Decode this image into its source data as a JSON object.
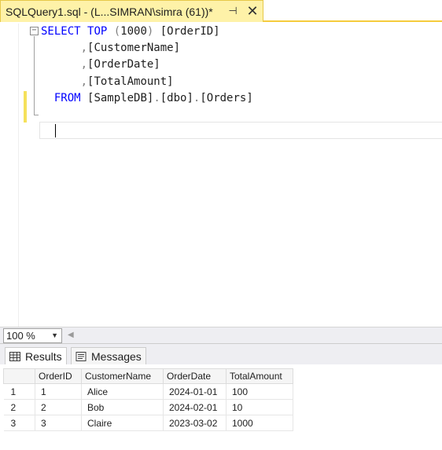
{
  "tab": {
    "title": "SQLQuery1.sql - (L...SIMRAN\\simra (61))*",
    "pin_glyph": "⊣",
    "close_glyph": "✕"
  },
  "editor": {
    "lines": [
      [
        {
          "t": "SELECT ",
          "c": "kw"
        },
        {
          "t": "TOP ",
          "c": "kw"
        },
        {
          "t": "(",
          "c": "pn"
        },
        {
          "t": "1000",
          "c": "num"
        },
        {
          "t": ") ",
          "c": "pn"
        },
        {
          "t": "[OrderID]",
          "c": "id"
        }
      ],
      [
        {
          "t": "      ",
          "c": "id"
        },
        {
          "t": ",",
          "c": "pn"
        },
        {
          "t": "[CustomerName]",
          "c": "id"
        }
      ],
      [
        {
          "t": "      ",
          "c": "id"
        },
        {
          "t": ",",
          "c": "pn"
        },
        {
          "t": "[OrderDate]",
          "c": "id"
        }
      ],
      [
        {
          "t": "      ",
          "c": "id"
        },
        {
          "t": ",",
          "c": "pn"
        },
        {
          "t": "[TotalAmount]",
          "c": "id"
        }
      ],
      [
        {
          "t": "  FROM ",
          "c": "kw"
        },
        {
          "t": "[SampleDB]",
          "c": "id"
        },
        {
          "t": ".",
          "c": "pn"
        },
        {
          "t": "[dbo]",
          "c": "id"
        },
        {
          "t": ".",
          "c": "pn"
        },
        {
          "t": "[Orders]",
          "c": "id"
        }
      ]
    ],
    "fold_glyph": "−"
  },
  "zoom": {
    "value": "100 %",
    "arrow": "▼",
    "scroll_left": "◀"
  },
  "results": {
    "tabs": [
      {
        "label": "Results",
        "icon": "grid-icon",
        "active": true
      },
      {
        "label": "Messages",
        "icon": "messages-icon",
        "active": false
      }
    ],
    "columns": [
      "OrderID",
      "CustomerName",
      "OrderDate",
      "TotalAmount"
    ],
    "rows": [
      {
        "rownum": "1",
        "cells": [
          "1",
          "Alice",
          "2024-01-01",
          "100"
        ]
      },
      {
        "rownum": "2",
        "cells": [
          "2",
          "Bob",
          "2024-02-01",
          "10"
        ]
      },
      {
        "rownum": "3",
        "cells": [
          "3",
          "Claire",
          "2023-03-02",
          "1000"
        ]
      }
    ]
  },
  "colors": {
    "tab_active": "#fef2a8",
    "tab_underline": "#f5cc3d",
    "keyword": "#0000ff",
    "change_marker": "#f5e15b"
  }
}
